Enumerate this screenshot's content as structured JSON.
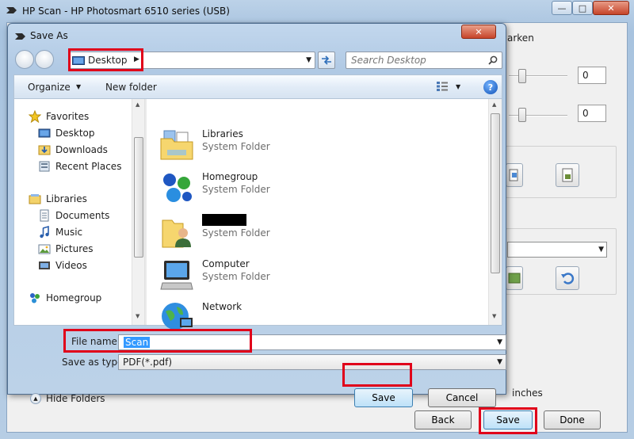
{
  "hp_window": {
    "title": "HP Scan - HP Photosmart 6510 series (USB)",
    "darken_label": "arken",
    "slider1_value": "0",
    "slider2_value": "0",
    "inches_label": "inches",
    "buttons": {
      "back": "Back",
      "save": "Save",
      "done": "Done"
    }
  },
  "dialog": {
    "title": "Save As",
    "address": {
      "location": "Desktop"
    },
    "search": {
      "placeholder": "Search Desktop"
    },
    "toolbar": {
      "organize": "Organize",
      "new_folder": "New folder",
      "help": "?"
    },
    "nav": {
      "favorites": "Favorites",
      "favorites_items": [
        "Desktop",
        "Downloads",
        "Recent Places"
      ],
      "libraries": "Libraries",
      "libraries_items": [
        "Documents",
        "Music",
        "Pictures",
        "Videos"
      ],
      "homegroup": "Homegroup"
    },
    "files": [
      {
        "name": "Libraries",
        "type": "System Folder",
        "icon": "libraries-icon"
      },
      {
        "name": "Homegroup",
        "type": "System Folder",
        "icon": "homegroup-icon"
      },
      {
        "name": "",
        "type": "System Folder",
        "icon": "user-folder-icon"
      },
      {
        "name": "Computer",
        "type": "System Folder",
        "icon": "computer-icon"
      },
      {
        "name": "Network",
        "type": "",
        "icon": "network-icon"
      }
    ],
    "filename_label": "File name:",
    "filename_value": "Scan",
    "saveastype_label": "Save as type:",
    "saveastype_value": "PDF(*.pdf)",
    "hide_folders": "Hide Folders",
    "buttons": {
      "save": "Save",
      "cancel": "Cancel"
    }
  },
  "colors": {
    "highlight": "#e0001a",
    "selection": "#3399ff"
  }
}
